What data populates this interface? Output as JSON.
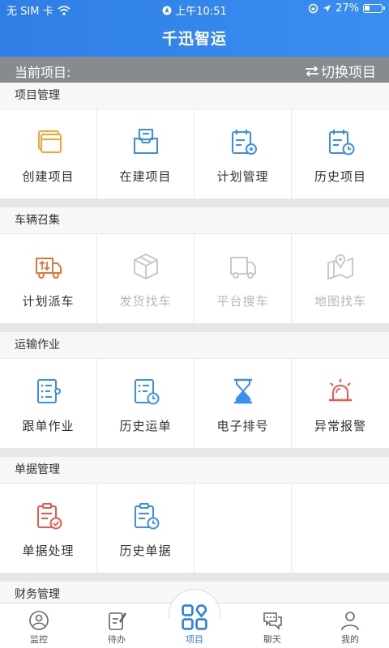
{
  "status": {
    "carrier": "无 SIM 卡",
    "time": "上午10:51",
    "battery": "27%"
  },
  "app_title": "千迅智运",
  "project_bar": {
    "label": "当前项目:",
    "switch_label": "切换项目"
  },
  "sections": [
    {
      "title": "项目管理",
      "items": [
        {
          "label": "创建项目",
          "icon": "create-project-icon",
          "color": "#f0a830",
          "disabled": false
        },
        {
          "label": "在建项目",
          "icon": "building-project-icon",
          "color": "#3a8ef0",
          "disabled": false
        },
        {
          "label": "计划管理",
          "icon": "plan-management-icon",
          "color": "#3a8ef0",
          "disabled": false
        },
        {
          "label": "历史项目",
          "icon": "history-project-icon",
          "color": "#3a8ef0",
          "disabled": false
        }
      ]
    },
    {
      "title": "车辆召集",
      "items": [
        {
          "label": "计划派车",
          "icon": "dispatch-truck-icon",
          "color": "#e8743b",
          "disabled": false
        },
        {
          "label": "发货找车",
          "icon": "package-icon",
          "color": "#c8c8c8",
          "disabled": true
        },
        {
          "label": "平台搜车",
          "icon": "truck-icon",
          "color": "#c8c8c8",
          "disabled": true
        },
        {
          "label": "地图找车",
          "icon": "map-icon",
          "color": "#c8c8c8",
          "disabled": true
        }
      ]
    },
    {
      "title": "运输作业",
      "items": [
        {
          "label": "跟单作业",
          "icon": "order-tracking-icon",
          "color": "#3a8ef0",
          "disabled": false
        },
        {
          "label": "历史运单",
          "icon": "history-waybill-icon",
          "color": "#3a8ef0",
          "disabled": false
        },
        {
          "label": "电子排号",
          "icon": "hourglass-icon",
          "color": "#3a8ef0",
          "disabled": false
        },
        {
          "label": "异常报警",
          "icon": "alarm-icon",
          "color": "#e85a4f",
          "disabled": false
        }
      ]
    },
    {
      "title": "单据管理",
      "items": [
        {
          "label": "单据处理",
          "icon": "document-process-icon",
          "color": "#e85a4f",
          "disabled": false
        },
        {
          "label": "历史单据",
          "icon": "history-document-icon",
          "color": "#3a8ef0",
          "disabled": false
        }
      ]
    },
    {
      "title": "财务管理",
      "items": []
    }
  ],
  "tabs": [
    {
      "label": "监控",
      "icon": "monitor-icon",
      "active": false
    },
    {
      "label": "待办",
      "icon": "todo-icon",
      "active": false
    },
    {
      "label": "项目",
      "icon": "project-icon",
      "active": true
    },
    {
      "label": "聊天",
      "icon": "chat-icon",
      "active": false
    },
    {
      "label": "我的",
      "icon": "profile-icon",
      "active": false
    }
  ]
}
